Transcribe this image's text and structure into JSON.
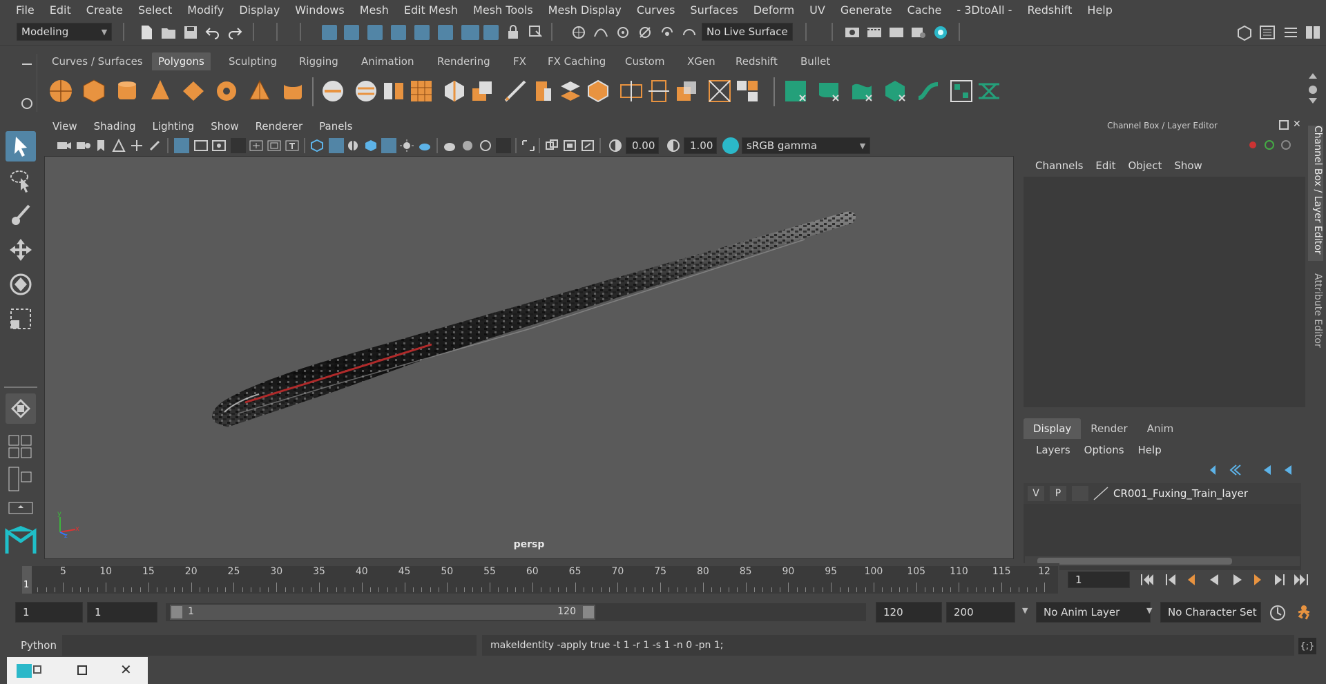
{
  "menubar": {
    "items": [
      "File",
      "Edit",
      "Create",
      "Select",
      "Modify",
      "Display",
      "Windows",
      "Mesh",
      "Edit Mesh",
      "Mesh Tools",
      "Mesh Display",
      "Curves",
      "Surfaces",
      "Deform",
      "UV",
      "Generate",
      "Cache",
      "- 3DtoAll -",
      "Redshift",
      "Help"
    ]
  },
  "statusline": {
    "mode_value": "Modeling",
    "live_surface": "No Live Surface"
  },
  "shelf": {
    "tabs": [
      "Curves / Surfaces",
      "Polygons",
      "Sculpting",
      "Rigging",
      "Animation",
      "Rendering",
      "FX",
      "FX Caching",
      "Custom",
      "XGen",
      "Redshift",
      "Bullet"
    ],
    "active_tab": "Polygons"
  },
  "viewport": {
    "menu": [
      "View",
      "Shading",
      "Lighting",
      "Show",
      "Renderer",
      "Panels"
    ],
    "exposure": "0.00",
    "gamma": "1.00",
    "color_space": "sRGB gamma",
    "camera_label": "persp",
    "axis_x": "x",
    "axis_y": "y",
    "axis_z": "z"
  },
  "rightpanel": {
    "title": "Channel Box / Layer Editor",
    "menu": [
      "Channels",
      "Edit",
      "Object",
      "Show"
    ],
    "tabs": [
      "Display",
      "Render",
      "Anim"
    ],
    "active_tab": "Display",
    "layer_menu": [
      "Layers",
      "Options",
      "Help"
    ],
    "layer": {
      "v": "V",
      "p": "P",
      "name": "CR001_Fuxing_Train_layer"
    }
  },
  "sidetabs": {
    "channel_box": "Channel Box / Layer Editor",
    "attribute_editor": "Attribute Editor"
  },
  "timeslider": {
    "start_label": "1",
    "ticks": [
      "5",
      "10",
      "15",
      "20",
      "25",
      "30",
      "35",
      "40",
      "45",
      "50",
      "55",
      "60",
      "65",
      "70",
      "75",
      "80",
      "85",
      "90",
      "95",
      "100",
      "105",
      "110",
      "115",
      "12"
    ],
    "current_frame": "1"
  },
  "range": {
    "start": "1",
    "playback_start": "1",
    "bar_start": "1",
    "bar_end": "120",
    "playback_end": "120",
    "end": "200",
    "anim_layer": "No Anim Layer",
    "character_set": "No Character Set"
  },
  "cmdline": {
    "language": "Python",
    "result": "makeIdentity -apply true -t 1 -r 1 -s 1 -n 0 -pn 1;"
  },
  "colors": {
    "accent": "#5285a6",
    "shelf_orange": "#e89340",
    "shelf_teal": "#24a07a",
    "viewport_bg": "#5a5a5a"
  }
}
